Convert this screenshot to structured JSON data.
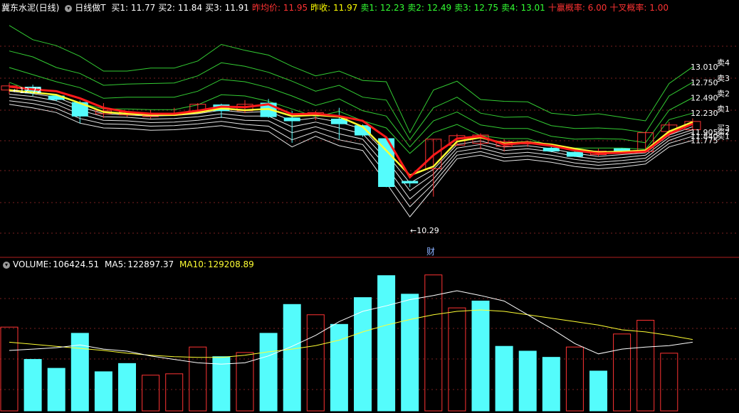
{
  "header": {
    "stock_name": "冀东水泥(日线)",
    "indicator_name": "日线做T",
    "items": [
      {
        "label": "买1:",
        "value": "11.77",
        "color": "#ffffff"
      },
      {
        "label": "买2:",
        "value": "11.84",
        "color": "#ffffff"
      },
      {
        "label": "买3:",
        "value": "11.91",
        "color": "#ffffff"
      },
      {
        "label": "昨均价:",
        "value": "11.95",
        "color": "#ff3333"
      },
      {
        "label": "昨收:",
        "value": "11.97",
        "color": "#ffff00"
      },
      {
        "label": "卖1:",
        "value": "12.23",
        "color": "#33ff33"
      },
      {
        "label": "卖2:",
        "value": "12.49",
        "color": "#33ff33"
      },
      {
        "label": "卖3:",
        "value": "12.75",
        "color": "#33ff33"
      },
      {
        "label": "卖4:",
        "value": "13.01",
        "color": "#33ff33"
      },
      {
        "label": "十赢概率:",
        "value": "6.00",
        "color": "#ff3333"
      },
      {
        "label": "十叉概率:",
        "value": "1.00",
        "color": "#ff3333"
      }
    ]
  },
  "volume_header": {
    "label": "VOLUME:",
    "value": "106424.51",
    "ma5_label": "MA5:",
    "ma5_value": "122897.37",
    "ma10_label": "MA10:",
    "ma10_value": "129208.89"
  },
  "chart_data": [
    {
      "type": "candlestick",
      "ylim": [
        10.0,
        13.9
      ],
      "candles": [
        {
          "o": 12.62,
          "c": 12.69,
          "h": 12.74,
          "l": 12.55
        },
        {
          "o": 12.67,
          "c": 12.57,
          "h": 12.71,
          "l": 12.52
        },
        {
          "o": 12.52,
          "c": 12.46,
          "h": 12.55,
          "l": 12.43
        },
        {
          "o": 12.41,
          "c": 12.18,
          "h": 12.44,
          "l": 12.06
        },
        {
          "o": 12.22,
          "c": 12.27,
          "h": 12.4,
          "l": 12.15
        },
        {
          "o": 12.2,
          "c": 12.25,
          "h": 12.27,
          "l": 12.17
        },
        {
          "o": 12.18,
          "c": 12.19,
          "h": 12.28,
          "l": 12.14
        },
        {
          "o": 12.2,
          "c": 12.22,
          "h": 12.32,
          "l": 12.18
        },
        {
          "o": 12.26,
          "c": 12.38,
          "h": 12.4,
          "l": 12.24
        },
        {
          "o": 12.37,
          "c": 12.27,
          "h": 12.39,
          "l": 12.15
        },
        {
          "o": 12.27,
          "c": 12.38,
          "h": 12.45,
          "l": 12.23
        },
        {
          "o": 12.4,
          "c": 12.17,
          "h": 12.47,
          "l": 12.15
        },
        {
          "o": 12.15,
          "c": 12.1,
          "h": 12.27,
          "l": 11.73
        },
        {
          "o": 12.22,
          "c": 12.24,
          "h": 12.27,
          "l": 12.11
        },
        {
          "o": 12.13,
          "c": 12.05,
          "h": 12.32,
          "l": 11.79
        },
        {
          "o": 12.02,
          "c": 11.86,
          "h": 12.04,
          "l": 11.83
        },
        {
          "o": 11.8,
          "c": 10.99,
          "h": 11.84,
          "l": 10.98
        },
        {
          "o": 11.08,
          "c": 11.05,
          "h": 11.09,
          "l": 10.98
        },
        {
          "o": 11.29,
          "c": 11.79,
          "h": 11.79,
          "l": 10.82
        },
        {
          "o": 11.69,
          "c": 11.85,
          "h": 11.88,
          "l": 11.68
        },
        {
          "o": 11.72,
          "c": 11.86,
          "h": 11.89,
          "l": 11.62
        },
        {
          "o": 11.67,
          "c": 11.75,
          "h": 11.79,
          "l": 11.58
        },
        {
          "o": 11.71,
          "c": 11.74,
          "h": 11.77,
          "l": 11.66
        },
        {
          "o": 11.64,
          "c": 11.59,
          "h": 11.66,
          "l": 11.57
        },
        {
          "o": 11.57,
          "c": 11.5,
          "h": 11.59,
          "l": 11.49
        },
        {
          "o": 11.53,
          "c": 11.59,
          "h": 11.63,
          "l": 11.5
        },
        {
          "o": 11.63,
          "c": 11.57,
          "h": 11.64,
          "l": 11.55
        },
        {
          "o": 11.58,
          "c": 11.9,
          "h": 11.92,
          "l": 11.56
        },
        {
          "o": 11.92,
          "c": 12.03,
          "h": 12.08,
          "l": 11.82
        },
        {
          "o": 11.95,
          "c": 12.09,
          "h": 12.14,
          "l": 11.94
        }
      ],
      "lines": {
        "red": [
          12.68,
          12.63,
          12.6,
          12.48,
          12.32,
          12.25,
          12.22,
          12.22,
          12.27,
          12.34,
          12.33,
          12.38,
          12.21,
          12.22,
          12.18,
          12.1,
          11.82,
          11.15,
          11.52,
          11.8,
          11.84,
          11.7,
          11.73,
          11.68,
          11.6,
          11.55,
          11.56,
          11.58,
          11.88,
          12.05
        ],
        "yellow": [
          12.62,
          12.58,
          12.54,
          12.4,
          12.25,
          12.22,
          12.2,
          12.2,
          12.24,
          12.31,
          12.28,
          12.3,
          12.18,
          12.2,
          12.17,
          12.0,
          11.6,
          11.18,
          11.33,
          11.75,
          11.82,
          11.72,
          11.74,
          11.7,
          11.63,
          11.57,
          11.58,
          11.6,
          11.92,
          12.08
        ],
        "green": [
          [
            13.71,
            13.47,
            13.37,
            13.19,
            12.94,
            12.94,
            12.99,
            12.99,
            13.11,
            13.39,
            13.29,
            13.21,
            13.02,
            12.86,
            12.94,
            12.78,
            12.76,
            11.9,
            12.62,
            12.77,
            12.46,
            12.43,
            12.42,
            12.23,
            12.19,
            12.22,
            12.16,
            12.1,
            12.73,
            13.01
          ],
          [
            13.28,
            13.18,
            13.0,
            12.9,
            12.7,
            12.72,
            12.73,
            12.74,
            12.86,
            13.08,
            13.02,
            12.92,
            12.77,
            12.6,
            12.7,
            12.5,
            12.45,
            11.78,
            12.32,
            12.5,
            12.23,
            12.16,
            12.17,
            12.02,
            11.97,
            11.98,
            11.96,
            11.9,
            12.52,
            12.75
          ],
          [
            13.0,
            12.88,
            12.76,
            12.66,
            12.48,
            12.5,
            12.5,
            12.5,
            12.6,
            12.8,
            12.76,
            12.66,
            12.52,
            12.36,
            12.47,
            12.27,
            12.18,
            11.66,
            12.1,
            12.25,
            12.03,
            11.97,
            11.97,
            11.84,
            11.79,
            11.8,
            11.79,
            11.73,
            12.28,
            12.49
          ],
          [
            12.75,
            12.6,
            12.52,
            12.4,
            12.3,
            12.3,
            12.29,
            12.29,
            12.37,
            12.54,
            12.52,
            12.43,
            12.3,
            12.17,
            12.26,
            12.1,
            11.98,
            11.55,
            11.9,
            12.04,
            11.85,
            11.8,
            11.8,
            11.68,
            11.64,
            11.64,
            11.64,
            11.62,
            12.12,
            12.23
          ]
        ],
        "white": [
          [
            12.6,
            12.56,
            12.5,
            12.34,
            12.22,
            12.2,
            12.18,
            12.19,
            12.22,
            12.28,
            12.24,
            12.26,
            12.1,
            12.15,
            12.08,
            11.96,
            11.55,
            11.05,
            11.28,
            11.7,
            11.76,
            11.66,
            11.68,
            11.63,
            11.55,
            11.5,
            11.53,
            11.56,
            11.86,
            12.0
          ],
          [
            12.55,
            12.51,
            12.44,
            12.28,
            12.17,
            12.16,
            12.13,
            12.14,
            12.17,
            12.22,
            12.18,
            12.18,
            12.0,
            12.08,
            11.98,
            11.88,
            11.45,
            10.92,
            11.2,
            11.64,
            11.7,
            11.6,
            11.63,
            11.58,
            11.5,
            11.45,
            11.48,
            11.52,
            11.82,
            11.95
          ],
          [
            12.5,
            12.45,
            12.38,
            12.21,
            12.11,
            12.1,
            12.07,
            12.08,
            12.11,
            12.16,
            12.11,
            12.1,
            11.9,
            12.0,
            11.88,
            11.79,
            11.33,
            10.78,
            11.12,
            11.58,
            11.64,
            11.54,
            11.57,
            11.52,
            11.45,
            11.4,
            11.43,
            11.47,
            11.77,
            11.91
          ],
          [
            12.44,
            12.39,
            12.31,
            12.14,
            12.05,
            12.04,
            12.01,
            12.02,
            12.05,
            12.09,
            12.04,
            12.01,
            11.78,
            11.92,
            11.78,
            11.7,
            11.2,
            10.65,
            11.04,
            11.52,
            11.58,
            11.48,
            11.51,
            11.46,
            11.39,
            11.35,
            11.38,
            11.42,
            11.72,
            11.84
          ],
          [
            12.38,
            12.32,
            12.24,
            12.06,
            11.98,
            11.97,
            11.94,
            11.95,
            11.98,
            12.02,
            11.96,
            11.92,
            11.66,
            11.84,
            11.68,
            11.6,
            11.05,
            10.48,
            10.96,
            11.46,
            11.52,
            11.42,
            11.45,
            11.4,
            11.33,
            11.29,
            11.32,
            11.37,
            11.66,
            11.77
          ]
        ]
      },
      "right_labels": [
        {
          "value": "13.010",
          "name": "卖4",
          "price": 13.01
        },
        {
          "value": "12.750",
          "name": "卖3",
          "price": 12.75
        },
        {
          "value": "12.490",
          "name": "卖2",
          "price": 12.49
        },
        {
          "value": "12.230",
          "name": "卖1",
          "price": 12.23
        },
        {
          "value": "11.905",
          "name": "买3",
          "price": 11.91
        },
        {
          "value": "11.840",
          "name": "买2",
          "price": 11.84
        },
        {
          "value": "11.775",
          "name": "买1",
          "price": 11.77
        }
      ],
      "annotations": {
        "high_label": "12.72",
        "low_label": "10.29",
        "finance_marker": "财"
      }
    },
    {
      "type": "bar",
      "ylim": [
        0,
        205000
      ],
      "values": [
        122000,
        75000,
        62000,
        113000,
        57000,
        69000,
        52000,
        54000,
        93000,
        79000,
        85000,
        113000,
        155000,
        140000,
        126000,
        165000,
        197000,
        170000,
        198000,
        150000,
        160000,
        94000,
        87000,
        78000,
        93000,
        58000,
        112000,
        132000,
        84000
      ],
      "up": [
        true,
        false,
        false,
        false,
        false,
        false,
        true,
        true,
        true,
        false,
        true,
        false,
        false,
        true,
        false,
        false,
        false,
        false,
        true,
        true,
        false,
        false,
        false,
        false,
        true,
        false,
        true,
        true,
        true
      ],
      "ma5": [
        88000,
        90000,
        92000,
        96000,
        90000,
        87000,
        80000,
        75000,
        70000,
        68000,
        70000,
        80000,
        94000,
        110000,
        130000,
        145000,
        153000,
        162000,
        168000,
        175000,
        168000,
        160000,
        140000,
        120000,
        98000,
        83000,
        90000,
        93000,
        95000,
        100000
      ],
      "ma10": [
        100000,
        97000,
        94000,
        91000,
        88000,
        84000,
        81000,
        79000,
        78000,
        78000,
        81000,
        86000,
        90000,
        95000,
        103000,
        115000,
        125000,
        133000,
        140000,
        145000,
        147000,
        145000,
        140000,
        135000,
        130000,
        125000,
        118000,
        115000,
        110000,
        104000
      ]
    }
  ],
  "colors": {
    "background": "#000000",
    "up": "#ff3333",
    "down": "#54fcfc",
    "red_line": "#ff1a1a",
    "yellow_line": "#ffff33",
    "green_line": "#33cc33",
    "white_line": "#e6e6e6",
    "grid": "#7a1f1f"
  }
}
